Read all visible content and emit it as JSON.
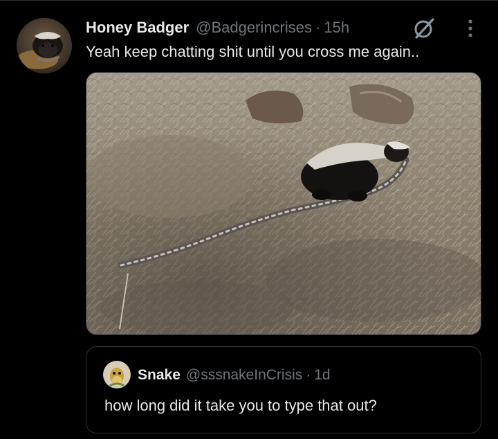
{
  "tweet": {
    "display_name": "Honey Badger",
    "handle": "@Badgerincrises",
    "separator": "·",
    "time": "15h",
    "text": "Yeah keep chatting shit until you cross me again..",
    "media": {
      "subject": "honey badger holding a long snake on dry grass"
    }
  },
  "quoted_tweet": {
    "display_name": "Snake",
    "handle": "@sssnakeInCrisis",
    "separator": "·",
    "time": "1d",
    "text": "how long did it take you to type that out?"
  },
  "icons": {
    "grok": "grok-icon",
    "more": "more-options-icon"
  },
  "colors": {
    "background": "#000000",
    "primary_text": "#e7e9ea",
    "secondary_text": "#71767b",
    "border": "#2f3336"
  }
}
